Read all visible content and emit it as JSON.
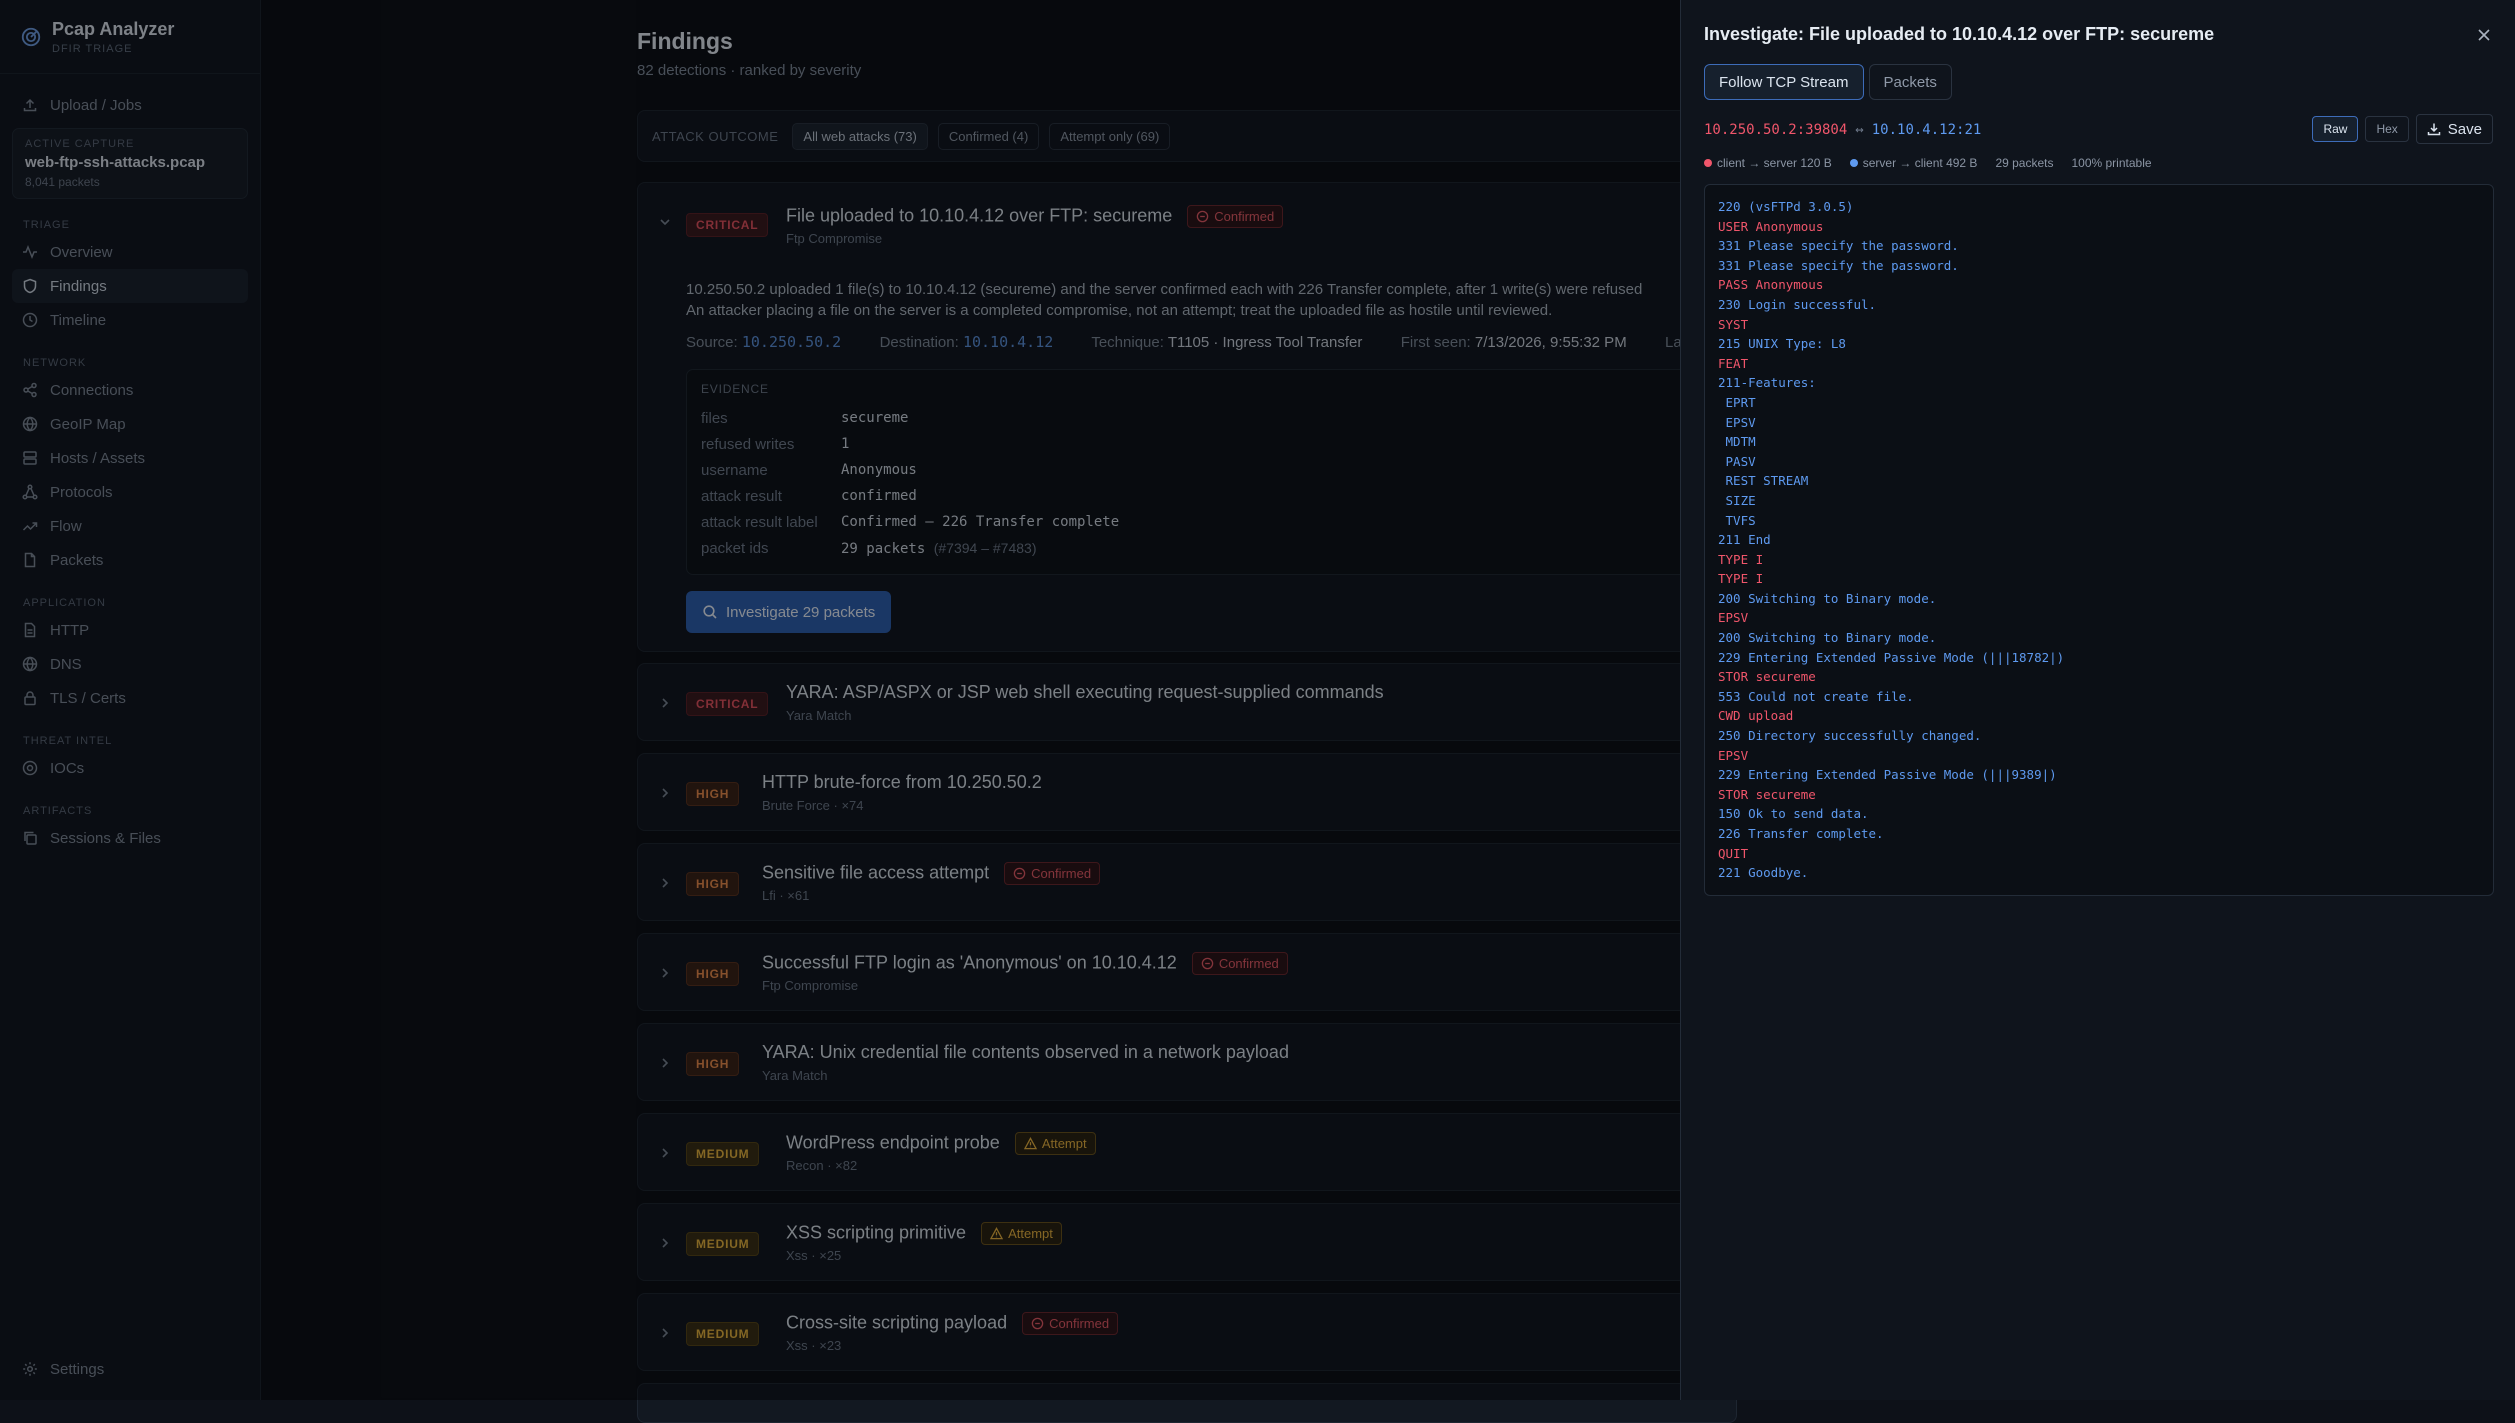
{
  "app": {
    "title": "Pcap Analyzer",
    "subtitle": "DFIR TRIAGE"
  },
  "sidebar": {
    "upload_label": "Upload / Jobs",
    "capture": {
      "label": "ACTIVE CAPTURE",
      "name": "web-ftp-ssh-attacks.pcap",
      "packets": "8,041 packets"
    },
    "sections": {
      "triage": "TRIAGE",
      "network": "NETWORK",
      "application": "APPLICATION",
      "threat_intel": "THREAT INTEL",
      "artifacts": "ARTIFACTS"
    },
    "items": {
      "overview": "Overview",
      "findings": "Findings",
      "timeline": "Timeline",
      "connections": "Connections",
      "geoip": "GeoIP Map",
      "hosts": "Hosts / Assets",
      "protocols": "Protocols",
      "flow": "Flow",
      "packets": "Packets",
      "http": "HTTP",
      "dns": "DNS",
      "tls": "TLS / Certs",
      "iocs": "IOCs",
      "sessions": "Sessions & Files",
      "settings": "Settings"
    }
  },
  "main": {
    "title": "Findings",
    "subtitle": "82 detections · ranked by severity",
    "filter": {
      "label": "ATTACK OUTCOME",
      "chips": [
        "All web attacks (73)",
        "Confirmed (4)",
        "Attempt only (69)"
      ]
    },
    "expanded": {
      "severity": "CRITICAL",
      "title": "File uploaded to 10.10.4.12 over FTP: secureme",
      "badge": "Confirmed",
      "category": "Ftp Compromise",
      "desc1": "10.250.50.2 uploaded 1 file(s) to 10.10.4.12 (secureme) and the server confirmed each with 226 Transfer complete, after 1 write(s) were refused",
      "desc2": "An attacker placing a file on the server is a completed compromise, not an attempt; treat the uploaded file as hostile until reviewed.",
      "source_label": "Source:",
      "source": "10.250.50.2",
      "dest_label": "Destination:",
      "dest": "10.10.4.12",
      "technique_label": "Technique:",
      "technique": "T1105 · Ingress Tool Transfer",
      "first_seen_label": "First seen:",
      "first_seen": "7/13/2026, 9:55:32 PM",
      "last_label": "La",
      "evidence_label": "EVIDENCE",
      "evidence": [
        {
          "k": "files",
          "v": "secureme"
        },
        {
          "k": "refused writes",
          "v": "1"
        },
        {
          "k": "username",
          "v": "Anonymous"
        },
        {
          "k": "attack result",
          "v": "confirmed"
        },
        {
          "k": "attack result label",
          "v": "Confirmed — 226 Transfer complete"
        },
        {
          "k": "packet ids",
          "v": "29 packets",
          "extra": "(#7394 – #7483)"
        }
      ],
      "investigate_label": "Investigate 29 packets"
    },
    "findings": [
      {
        "severity": "CRITICAL",
        "title": "YARA: ASP/ASPX or JSP web shell executing request-supplied commands",
        "sub": "Yara Match",
        "badge": ""
      },
      {
        "severity": "HIGH",
        "title": "HTTP brute-force from 10.250.50.2",
        "sub": "Brute Force · ×74",
        "badge": ""
      },
      {
        "severity": "HIGH",
        "title": "Sensitive file access attempt",
        "sub": "Lfi · ×61",
        "badge": "Confirmed"
      },
      {
        "severity": "HIGH",
        "title": "Successful FTP login as 'Anonymous' on 10.10.4.12",
        "sub": "Ftp Compromise",
        "badge": "Confirmed"
      },
      {
        "severity": "HIGH",
        "title": "YARA: Unix credential file contents observed in a network payload",
        "sub": "Yara Match",
        "badge": ""
      },
      {
        "severity": "MEDIUM",
        "title": "WordPress endpoint probe",
        "sub": "Recon · ×82",
        "badge": "Attempt"
      },
      {
        "severity": "MEDIUM",
        "title": "XSS scripting primitive",
        "sub": "Xss · ×25",
        "badge": "Attempt"
      },
      {
        "severity": "MEDIUM",
        "title": "Cross-site scripting payload",
        "sub": "Xss · ×23",
        "badge": "Confirmed"
      }
    ]
  },
  "panel": {
    "title": "Investigate: File uploaded to 10.10.4.12 over FTP: secureme",
    "tabs": [
      "Follow TCP Stream",
      "Packets"
    ],
    "client_ep": "10.250.50.2:39804",
    "arrow": "↔",
    "server_ep": "10.10.4.12:21",
    "raw_label": "Raw",
    "hex_label": "Hex",
    "save_label": "Save",
    "legend": {
      "client": "client → server 120 B",
      "server": "server → client 492 B",
      "packets": "29 packets",
      "printable": "100% printable"
    },
    "colors": {
      "client": "#f0566b",
      "server": "#5e9af0"
    },
    "stream": [
      {
        "d": "s",
        "t": "220 (vsFTPd 3.0.5)"
      },
      {
        "d": "c",
        "t": "USER Anonymous"
      },
      {
        "d": "s",
        "t": "331 Please specify the password."
      },
      {
        "d": "s",
        "t": "331 Please specify the password."
      },
      {
        "d": "c",
        "t": "PASS Anonymous"
      },
      {
        "d": "s",
        "t": "230 Login successful."
      },
      {
        "d": "c",
        "t": "SYST"
      },
      {
        "d": "s",
        "t": "215 UNIX Type: L8"
      },
      {
        "d": "c",
        "t": "FEAT"
      },
      {
        "d": "s",
        "t": "211-Features:"
      },
      {
        "d": "s",
        "t": " EPRT"
      },
      {
        "d": "s",
        "t": " EPSV"
      },
      {
        "d": "s",
        "t": " MDTM"
      },
      {
        "d": "s",
        "t": " PASV"
      },
      {
        "d": "s",
        "t": " REST STREAM"
      },
      {
        "d": "s",
        "t": " SIZE"
      },
      {
        "d": "s",
        "t": " TVFS"
      },
      {
        "d": "s",
        "t": "211 End"
      },
      {
        "d": "c",
        "t": "TYPE I"
      },
      {
        "d": "c",
        "t": "TYPE I"
      },
      {
        "d": "s",
        "t": "200 Switching to Binary mode."
      },
      {
        "d": "c",
        "t": "EPSV"
      },
      {
        "d": "s",
        "t": "200 Switching to Binary mode."
      },
      {
        "d": "s",
        "t": "229 Entering Extended Passive Mode (|||18782|)"
      },
      {
        "d": "c",
        "t": "STOR secureme"
      },
      {
        "d": "s",
        "t": "553 Could not create file."
      },
      {
        "d": "c",
        "t": "CWD upload"
      },
      {
        "d": "s",
        "t": "250 Directory successfully changed."
      },
      {
        "d": "c",
        "t": "EPSV"
      },
      {
        "d": "s",
        "t": "229 Entering Extended Passive Mode (|||9389|)"
      },
      {
        "d": "c",
        "t": "STOR secureme"
      },
      {
        "d": "s",
        "t": "150 Ok to send data."
      },
      {
        "d": "s",
        "t": "226 Transfer complete."
      },
      {
        "d": "c",
        "t": "QUIT"
      },
      {
        "d": "s",
        "t": "221 Goodbye."
      }
    ]
  }
}
